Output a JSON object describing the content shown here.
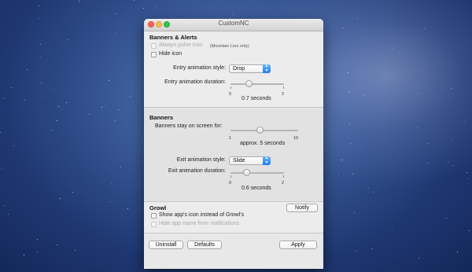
{
  "window": {
    "title": "CustomNC"
  },
  "banners_alerts": {
    "heading": "Banners & Alerts",
    "always_pulse_label": "Always pulse icon",
    "always_pulse_note": "(Mountain Lion only)",
    "hide_icon_label": "Hide icon",
    "entry_style_label": "Entry animation style:",
    "entry_style_value": "Drop",
    "entry_duration_label": "Entry animation duration:",
    "entry_min": "0",
    "entry_max": "2",
    "entry_duration_value": "0.7 seconds",
    "entry_duration_level": 0.35
  },
  "banners": {
    "heading": "Banners",
    "stay_label": "Banners stay on screen for:",
    "stay_min": "1",
    "stay_max": "10",
    "stay_value": "approx. 5 seconds",
    "stay_level": 0.44,
    "exit_style_label": "Exit animation style:",
    "exit_style_value": "Slide",
    "exit_duration_label": "Exit animation duration:",
    "exit_min": "0",
    "exit_max": "2",
    "exit_duration_value": "0.6 seconds",
    "exit_duration_level": 0.3
  },
  "growl": {
    "heading": "Growl",
    "notify_button": "Notify",
    "show_icon_label": "Show app's icon instead of Growl's",
    "hide_app_name_label": "Hide app name from notifications"
  },
  "footer": {
    "uninstall_button": "Uninstall",
    "defaults_button": "Defaults",
    "apply_button": "Apply"
  }
}
